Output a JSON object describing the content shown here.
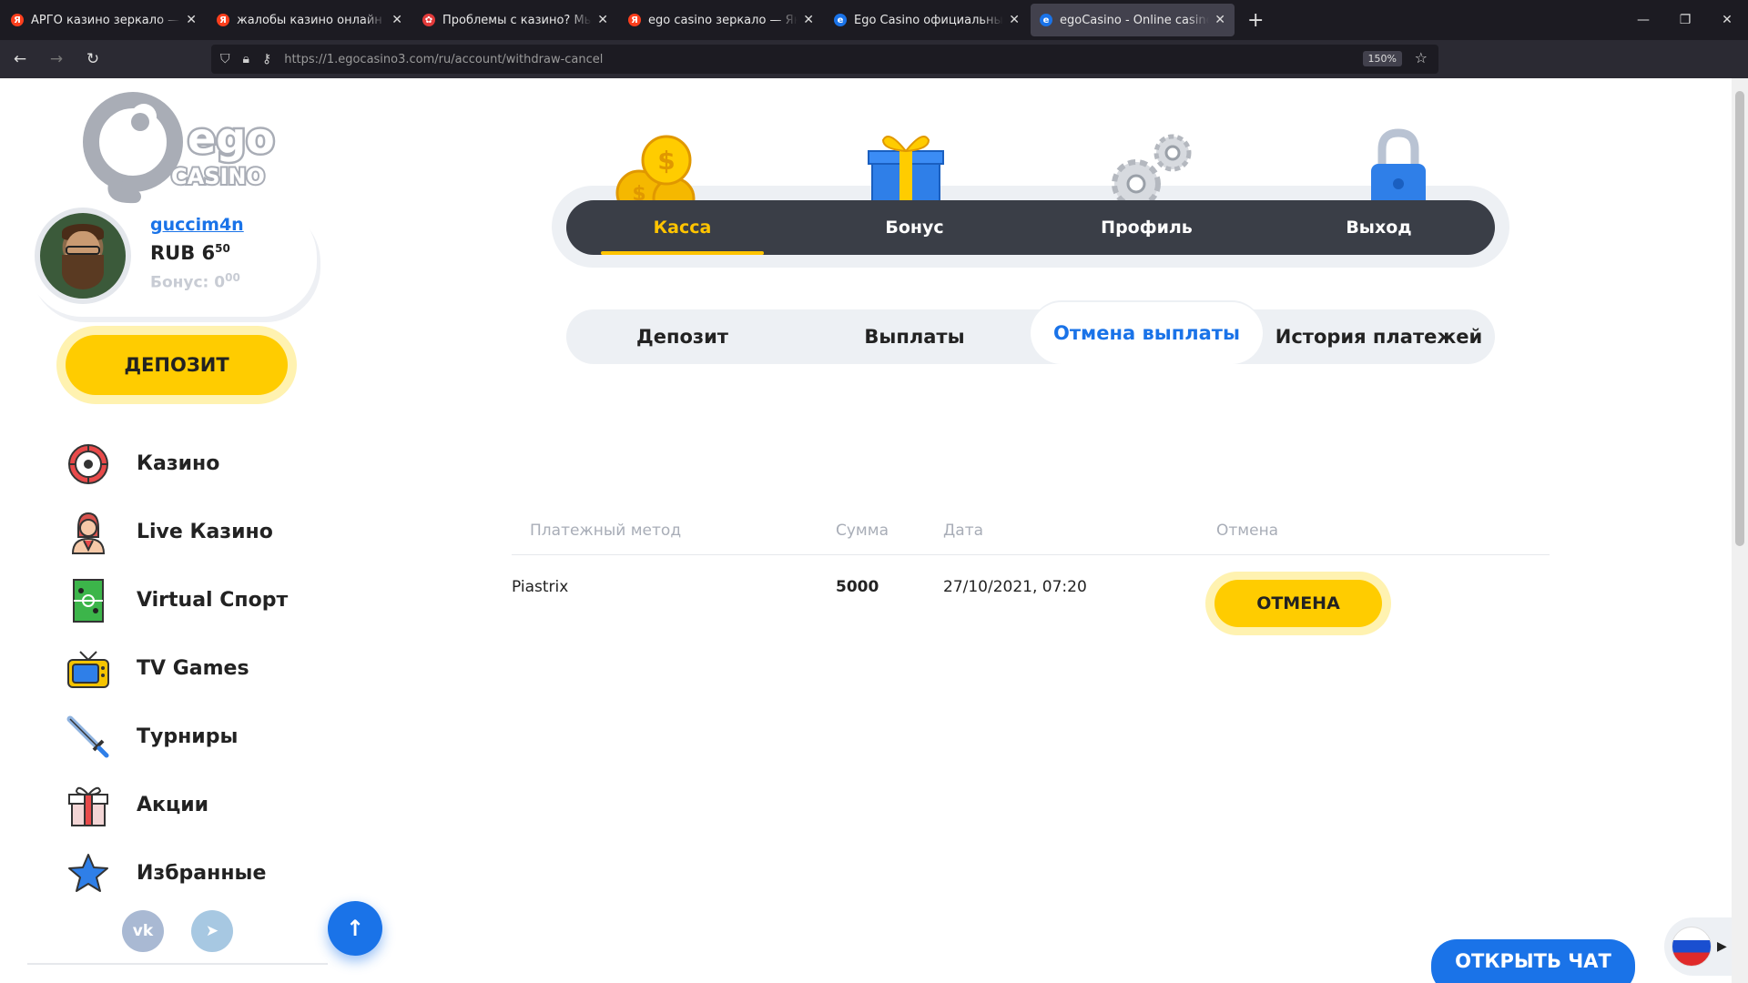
{
  "browser": {
    "tabs": [
      {
        "title": "АРГО казино зеркало — Яндекс",
        "favicon": "yandex-icon",
        "color": "#fc3f1d",
        "active": false
      },
      {
        "title": "жалобы казино онлайн — Яндекс",
        "favicon": "yandex-icon",
        "color": "#fc3f1d",
        "active": false
      },
      {
        "title": "Проблемы с казино? Мы здесь",
        "favicon": "chip-icon",
        "color": "#e23a3a",
        "active": false
      },
      {
        "title": "ego casino зеркало — Яндекс",
        "favicon": "yandex-icon",
        "color": "#fc3f1d",
        "active": false
      },
      {
        "title": "Ego Casino официальный сайт",
        "favicon": "ego-icon",
        "color": "#1a73e8",
        "active": false
      },
      {
        "title": "egoCasino - Online casino, slots",
        "favicon": "ego-icon",
        "color": "#1a73e8",
        "active": true
      }
    ],
    "url": "https://1.egocasino3.com/ru/account/withdraw-cancel",
    "zoom": "150%"
  },
  "sidebar": {
    "logo_text_top": "ego",
    "logo_text_bottom": "CASINO",
    "username": "guccim4n",
    "balance_main": "RUB 6",
    "balance_cents": "50",
    "bonus_main": "Бонус: 0",
    "bonus_cents": "00",
    "deposit_label": "ДЕПОЗИТ",
    "menu": [
      {
        "label": "Казино",
        "icon": "roulette-icon"
      },
      {
        "label": "Live Казино",
        "icon": "dealer-icon"
      },
      {
        "label": "Virtual Спорт",
        "icon": "field-icon"
      },
      {
        "label": "TV Games",
        "icon": "tv-icon"
      },
      {
        "label": "Турниры",
        "icon": "swords-icon"
      },
      {
        "label": "Акции",
        "icon": "gift-icon"
      },
      {
        "label": "Избранные",
        "icon": "star-icon"
      }
    ],
    "social": [
      "vk-icon",
      "telegram-icon"
    ]
  },
  "categories": [
    {
      "label": "Касса",
      "icon": "coins-icon",
      "active": true
    },
    {
      "label": "Бонус",
      "icon": "gift-box-icon",
      "active": false
    },
    {
      "label": "Профиль",
      "icon": "gears-icon",
      "active": false
    },
    {
      "label": "Выход",
      "icon": "padlock-icon",
      "active": false
    }
  ],
  "subtabs": [
    {
      "label": "Депозит",
      "active": false
    },
    {
      "label": "Выплаты",
      "active": false
    },
    {
      "label": "Отмена выплаты",
      "active": true
    },
    {
      "label": "История платежей",
      "active": false
    }
  ],
  "table": {
    "headers": [
      "Платежный метод",
      "Сумма",
      "Дата",
      "Отмена"
    ],
    "rows": [
      {
        "method": "Piastrix",
        "amount": "5000",
        "date": "27/10/2021, 07:20",
        "action": "ОТМЕНА"
      }
    ]
  },
  "chat_label": "ОТКРЫТЬ ЧАТ",
  "colors": {
    "accent_blue": "#1a73e8",
    "accent_yellow": "#ffcc00",
    "dark_bar": "#3a3e47"
  }
}
